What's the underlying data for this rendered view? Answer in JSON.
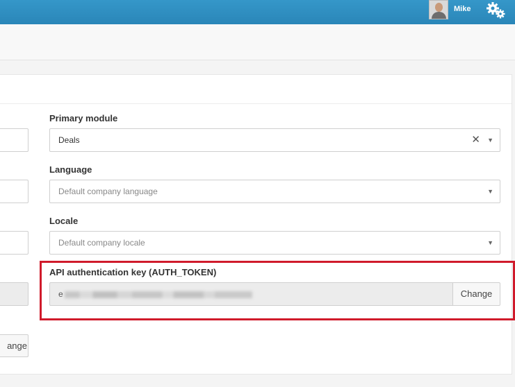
{
  "topbar": {
    "user_name": "Mike",
    "avatar_icon": "user-avatar-icon",
    "settings_icon": "gears-icon",
    "bar_color": "#2f8ec1"
  },
  "form": {
    "primary_module": {
      "label": "Primary module",
      "value": "Deals"
    },
    "language": {
      "label": "Language",
      "placeholder": "Default company language"
    },
    "locale": {
      "label": "Locale",
      "placeholder": "Default company locale"
    },
    "api_key": {
      "label": "API authentication key (AUTH_TOKEN)",
      "value_visible_prefix": "e",
      "change_label": "Change"
    },
    "left_button_partial_label": "ange"
  },
  "highlight_color": "#d01a2b"
}
